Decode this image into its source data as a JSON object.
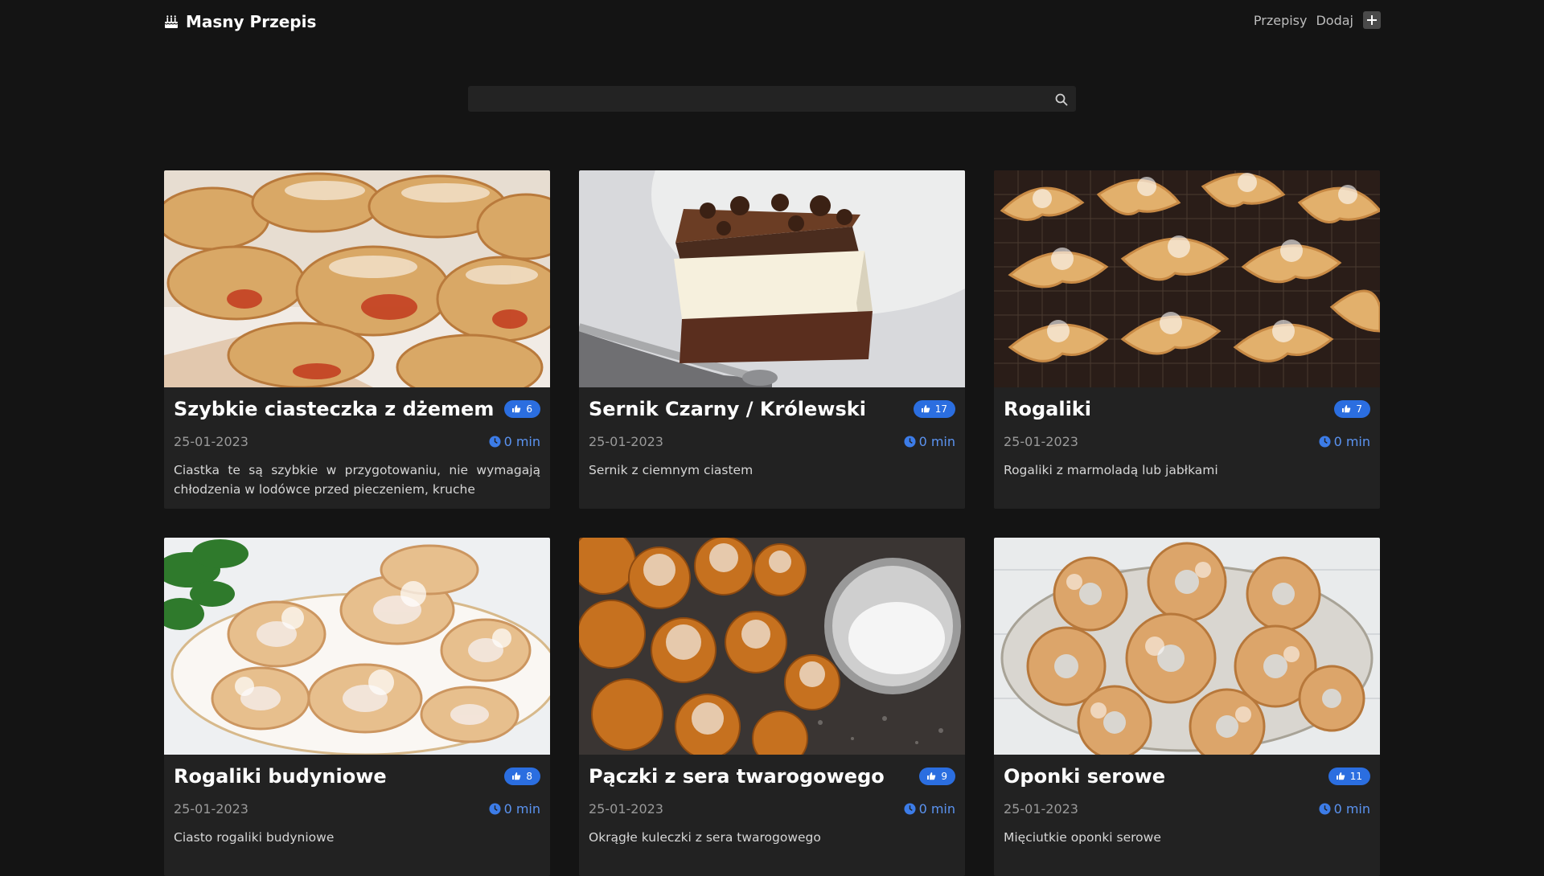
{
  "nav": {
    "brand": "Masny Przepis",
    "links": [
      "Przepisy",
      "Dodaj"
    ],
    "brand_icon": "birthday-cake-icon",
    "add_icon": "plus-icon"
  },
  "search": {
    "placeholder": "",
    "value": "",
    "icon": "search-icon"
  },
  "colors": {
    "background": "#141414",
    "card": "#222222",
    "badge": "#2b6ee0",
    "time": "#5b93f0"
  },
  "recipes": [
    {
      "title": "Szybkie ciasteczka z dżemem",
      "likes": "6",
      "date": "25-01-2023",
      "time": "0 min",
      "desc": "Ciastka te są szybkie w przygotowaniu, nie wymagają chłodzenia w lodówce przed pieczeniem, kruche"
    },
    {
      "title": "Sernik Czarny / Królewski",
      "likes": "17",
      "date": "25-01-2023",
      "time": "0 min",
      "desc": "Sernik z ciemnym ciastem"
    },
    {
      "title": "Rogaliki",
      "likes": "7",
      "date": "25-01-2023",
      "time": "0 min",
      "desc": "Rogaliki z marmoladą lub jabłkami"
    },
    {
      "title": "Rogaliki budyniowe",
      "likes": "8",
      "date": "25-01-2023",
      "time": "0 min",
      "desc": "Ciasto rogaliki budyniowe"
    },
    {
      "title": "Pączki z sera twarogowego",
      "likes": "9",
      "date": "25-01-2023",
      "time": "0 min",
      "desc": "Okrągłe kuleczki z sera twarogowego"
    },
    {
      "title": "Oponki serowe",
      "likes": "11",
      "date": "25-01-2023",
      "time": "0 min",
      "desc": "Mięciutkie oponki serowe"
    }
  ]
}
